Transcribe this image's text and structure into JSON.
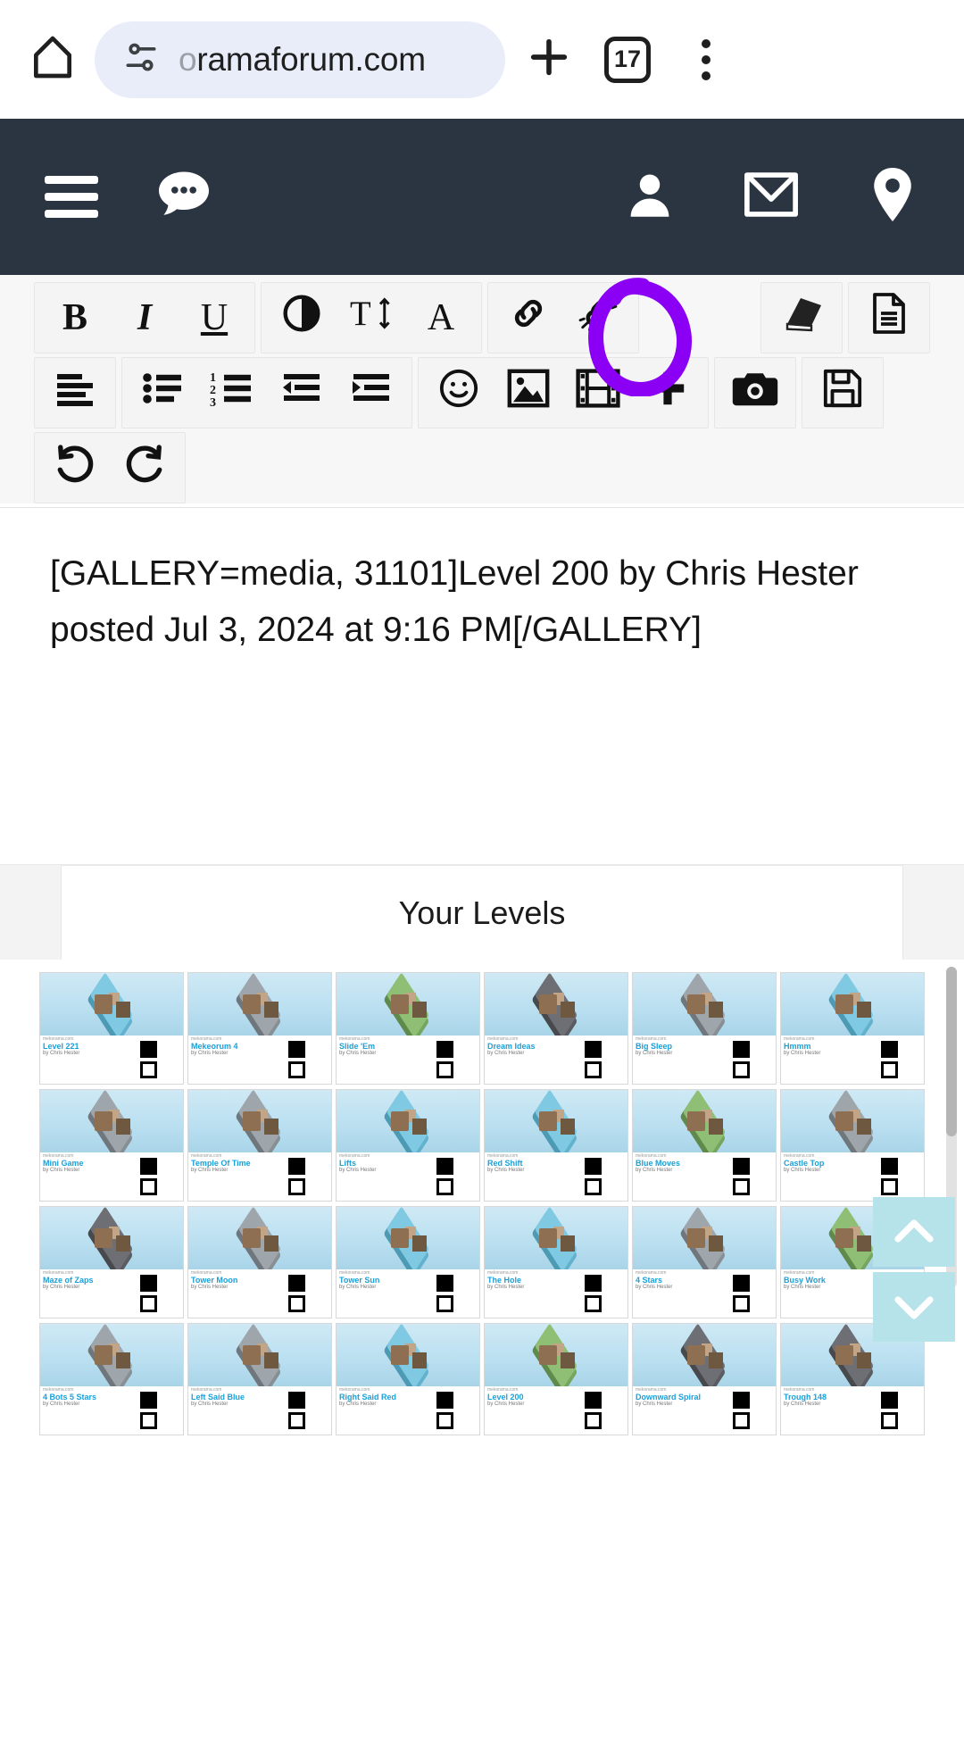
{
  "browser": {
    "home_icon": "home-icon",
    "site_settings_icon": "tune-icon",
    "url_faded": "o",
    "url_rest": "ramaforum.com",
    "new_tab_icon": "plus-icon",
    "tab_count": "17",
    "menu_icon": "kebab-menu-icon"
  },
  "forum_nav": {
    "menu_icon": "hamburger-icon",
    "chat_icon": "speech-bubble-icon",
    "account_icon": "person-icon",
    "inbox_icon": "envelope-icon",
    "location_icon": "map-pin-icon"
  },
  "editor": {
    "toolbar_rows": [
      {
        "groups": [
          {
            "buttons": [
              {
                "name": "bold-button",
                "glyph": "B",
                "style": "bold"
              },
              {
                "name": "italic-button",
                "glyph": "I",
                "style": "italic"
              },
              {
                "name": "underline-button",
                "glyph": "U",
                "style": "underline"
              }
            ]
          },
          {
            "buttons": [
              {
                "name": "text-color-button",
                "glyph": "◐",
                "style": "plain"
              },
              {
                "name": "font-size-button",
                "glyph": "T↕",
                "style": "plain"
              },
              {
                "name": "font-family-button",
                "glyph": "A",
                "style": "plain"
              }
            ]
          },
          {
            "buttons": [
              {
                "name": "insert-link-button",
                "glyph": "link",
                "style": "svg"
              },
              {
                "name": "unlink-button",
                "glyph": "unlink",
                "style": "svg"
              }
            ]
          },
          {
            "buttons": [
              {
                "name": "remove-formatting-button",
                "glyph": "eraser",
                "style": "svg"
              }
            ]
          },
          {
            "buttons": [
              {
                "name": "drafts-button",
                "glyph": "document",
                "style": "svg"
              }
            ]
          }
        ]
      },
      {
        "groups": [
          {
            "buttons": [
              {
                "name": "align-left-button",
                "glyph": "align-left",
                "style": "svg"
              }
            ]
          },
          {
            "buttons": [
              {
                "name": "bullet-list-button",
                "glyph": "bullet-list",
                "style": "svg"
              },
              {
                "name": "numbered-list-button",
                "glyph": "numbered-list",
                "style": "svg"
              },
              {
                "name": "outdent-button",
                "glyph": "outdent",
                "style": "svg"
              },
              {
                "name": "indent-button",
                "glyph": "indent",
                "style": "svg"
              }
            ]
          },
          {
            "buttons": [
              {
                "name": "emoji-button",
                "glyph": "smiley",
                "style": "svg"
              },
              {
                "name": "insert-image-button",
                "glyph": "image",
                "style": "svg"
              },
              {
                "name": "insert-video-button",
                "glyph": "film",
                "style": "svg"
              },
              {
                "name": "more-options-button",
                "glyph": "plus",
                "style": "svg"
              }
            ]
          },
          {
            "buttons": [
              {
                "name": "camera-button",
                "glyph": "camera",
                "style": "svg"
              }
            ]
          },
          {
            "buttons": [
              {
                "name": "save-draft-button",
                "glyph": "floppy",
                "style": "svg"
              }
            ]
          }
        ]
      },
      {
        "groups": [
          {
            "buttons": [
              {
                "name": "undo-button",
                "glyph": "undo",
                "style": "svg"
              },
              {
                "name": "redo-button",
                "glyph": "redo",
                "style": "svg"
              }
            ]
          }
        ]
      }
    ],
    "body_text": "[GALLERY=media, 31101]Level 200 by Chris Hester posted Jul 3, 2024 at 9:16 PM[/GALLERY]"
  },
  "annotation": {
    "name": "purple-circle-annotation",
    "color": "#8b00f5",
    "target": "camera-button"
  },
  "levels": {
    "title": "Your Levels",
    "site_label": "mekorama.com",
    "by_label": "by",
    "author": "Chris Hester",
    "scroll_up_label": "❯",
    "scroll_down_label": "❯",
    "cards": [
      {
        "name": "Level 221",
        "theme": "water"
      },
      {
        "name": "Mekeorum 4",
        "theme": "stone"
      },
      {
        "name": "Slide 'Em",
        "theme": "green"
      },
      {
        "name": "Dream Ideas",
        "theme": "dark"
      },
      {
        "name": "Big Sleep",
        "theme": "stone"
      },
      {
        "name": "Hmmm",
        "theme": "water"
      },
      {
        "name": "Mini Game",
        "theme": "stone"
      },
      {
        "name": "Temple Of Time",
        "theme": "stone"
      },
      {
        "name": "Lifts",
        "theme": "water"
      },
      {
        "name": "Red Shift",
        "theme": "water"
      },
      {
        "name": "Blue Moves",
        "theme": "green"
      },
      {
        "name": "Castle Top",
        "theme": "stone"
      },
      {
        "name": "Maze of Zaps",
        "theme": "dark"
      },
      {
        "name": "Tower Moon",
        "theme": "stone"
      },
      {
        "name": "Tower Sun",
        "theme": "water"
      },
      {
        "name": "The Hole",
        "theme": "water"
      },
      {
        "name": "4 Stars",
        "theme": "stone"
      },
      {
        "name": "Busy Work",
        "theme": "green"
      },
      {
        "name": "4 Bots 5 Stars",
        "theme": "stone"
      },
      {
        "name": "Left Said Blue",
        "theme": "stone"
      },
      {
        "name": "Right Said Red",
        "theme": "water"
      },
      {
        "name": "Level 200",
        "theme": "green"
      },
      {
        "name": "Downward Spiral",
        "theme": "dark"
      },
      {
        "name": "Trough 148",
        "theme": "dark"
      }
    ]
  }
}
